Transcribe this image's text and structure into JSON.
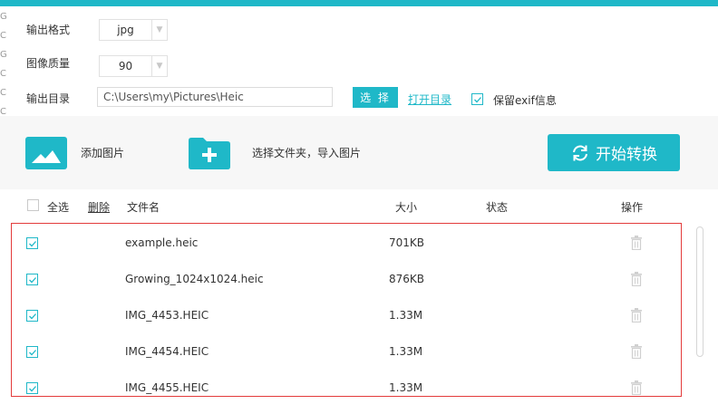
{
  "settings": {
    "format_label": "输出格式",
    "format_value": "jpg",
    "quality_label": "图像质量",
    "quality_value": "90",
    "dir_label": "输出目录",
    "dir_value": "C:\\Users\\my\\Pictures\\Heic",
    "choose_button": "选 择",
    "open_dir_link": "打开目录",
    "keep_exif_label": "保留exif信息",
    "keep_exif_checked": true
  },
  "edge_glyphs": [
    "G",
    "C",
    "G",
    "C",
    "C",
    "C"
  ],
  "toolbar": {
    "add_images": "添加图片",
    "add_folder": "选择文件夹，导入图片",
    "start_button": "开始转换"
  },
  "table": {
    "select_all": "全选",
    "delete_link": "删除",
    "columns": {
      "name": "文件名",
      "size": "大小",
      "status": "状态",
      "action": "操作"
    },
    "rows": [
      {
        "name": "example.heic",
        "size": "701KB",
        "status": ""
      },
      {
        "name": "Growing_1024x1024.heic",
        "size": "876KB",
        "status": ""
      },
      {
        "name": "IMG_4453.HEIC",
        "size": "1.33M",
        "status": ""
      },
      {
        "name": "IMG_4454.HEIC",
        "size": "1.33M",
        "status": ""
      },
      {
        "name": "IMG_4455.HEIC",
        "size": "1.33M",
        "status": ""
      }
    ]
  },
  "colors": {
    "accent": "#1fb8c8",
    "selection_border": "#e33c3c"
  }
}
